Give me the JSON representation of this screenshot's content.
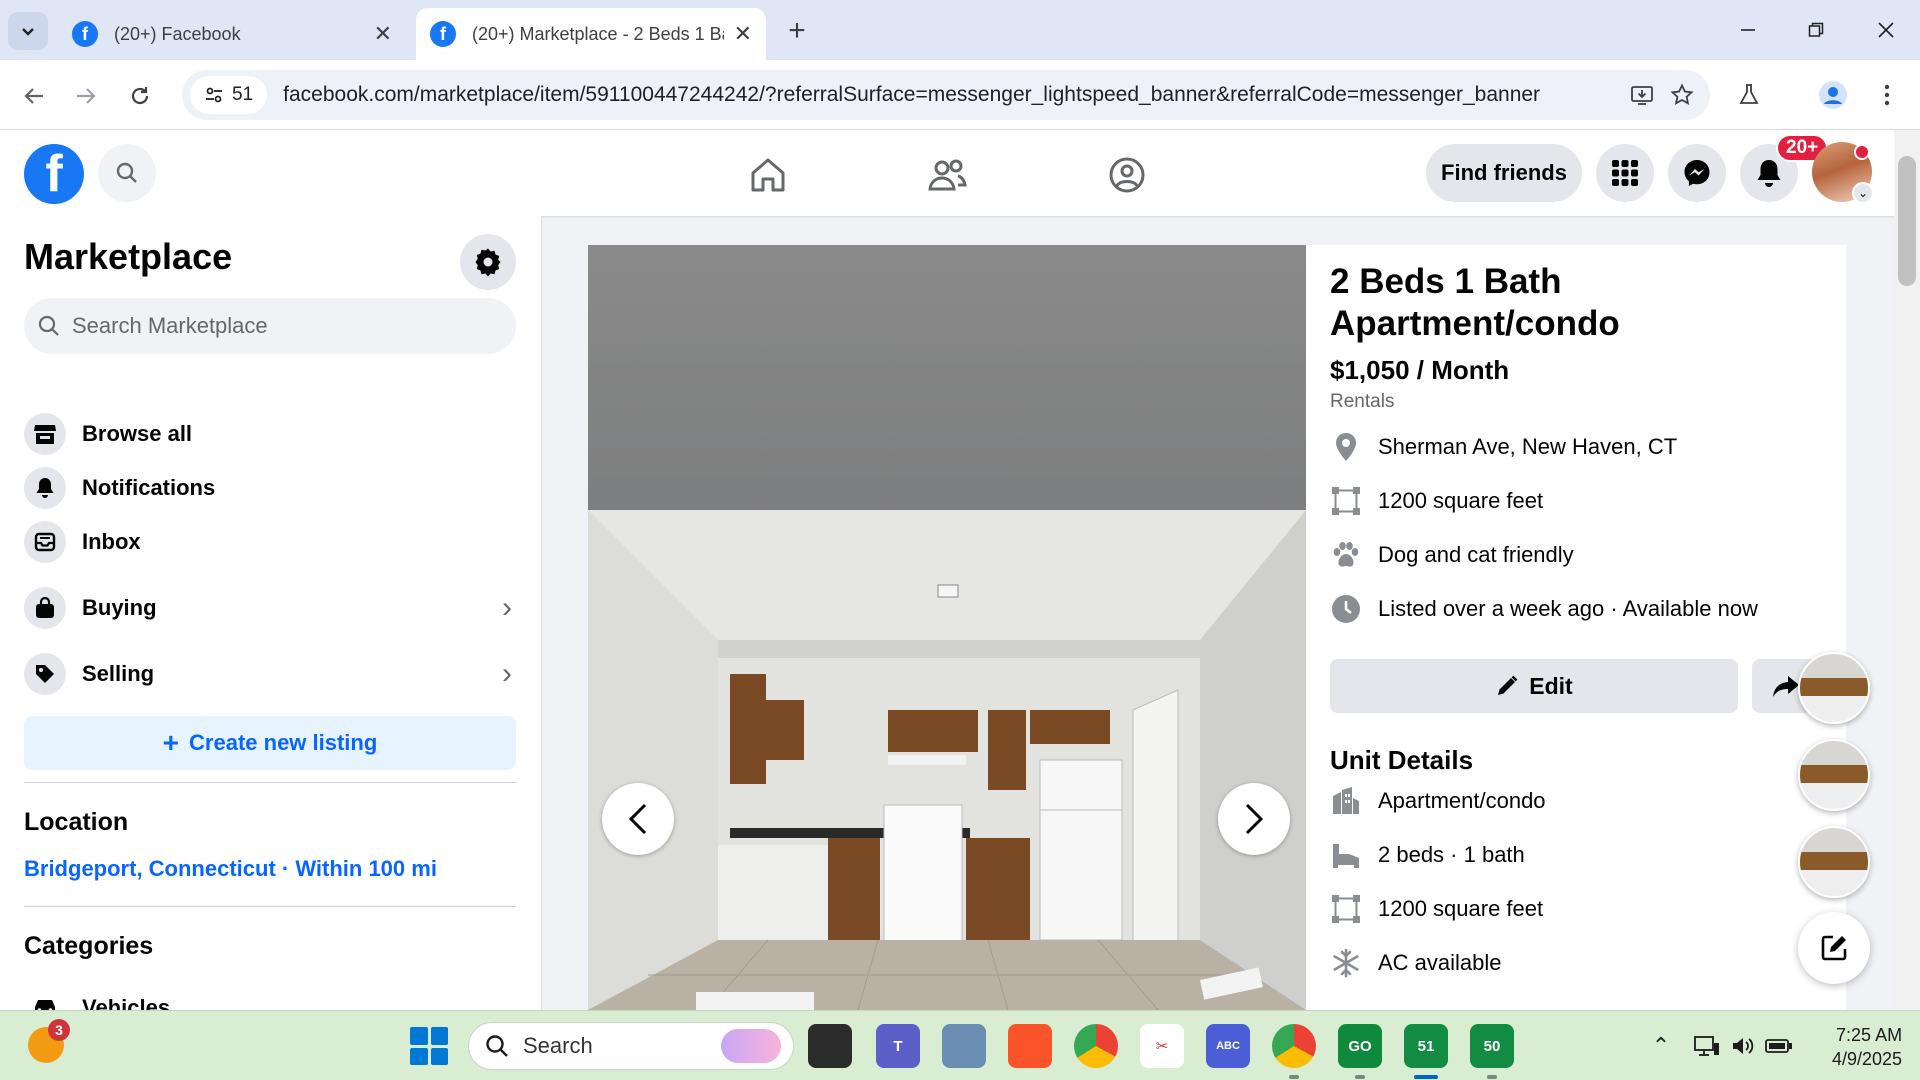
{
  "browser": {
    "tabs": [
      {
        "title": "(20+) Facebook",
        "active": false
      },
      {
        "title": "(20+) Marketplace - 2 Beds 1 Ba",
        "active": true
      }
    ],
    "site_chip_count": "51",
    "url": "facebook.com/marketplace/item/591100447244242/?referralSurface=messenger_lightspeed_banner&referralCode=messenger_banner"
  },
  "fb_header": {
    "logo": "f",
    "find_friends_label": "Find friends",
    "notifications_badge": "20+"
  },
  "sidebar": {
    "title": "Marketplace",
    "search_placeholder": "Search Marketplace",
    "items": [
      {
        "label": "Browse all",
        "icon": "storefront-icon"
      },
      {
        "label": "Notifications",
        "icon": "bell-icon"
      },
      {
        "label": "Inbox",
        "icon": "inbox-icon"
      },
      {
        "label": "Buying",
        "icon": "shopping-bag-icon"
      },
      {
        "label": "Selling",
        "icon": "price-tag-icon"
      }
    ],
    "create_listing_label": "Create new listing",
    "location_heading": "Location",
    "location_value": "Bridgeport, Connecticut · Within 100 mi",
    "categories_heading": "Categories",
    "first_category": "Vehicles"
  },
  "listing": {
    "title": "2 Beds 1 Bath Apartment/condo",
    "price": "$1,050 / Month",
    "category": "Rentals",
    "facts": [
      {
        "text": "Sherman Ave, New Haven, CT",
        "icon": "location-pin-icon"
      },
      {
        "text": "1200 square feet",
        "icon": "area-icon"
      },
      {
        "text": "Dog and cat friendly",
        "icon": "paw-icon"
      },
      {
        "text": "Listed over a week ago · Available now",
        "icon": "clock-icon"
      }
    ],
    "edit_label": "Edit",
    "unit_details_heading": "Unit Details",
    "unit_details": [
      {
        "text": "Apartment/condo",
        "icon": "building-icon"
      },
      {
        "text": "2 beds · 1 bath",
        "icon": "bed-icon"
      },
      {
        "text": "1200 square feet",
        "icon": "area-icon"
      },
      {
        "text": "AC available",
        "icon": "snowflake-icon"
      }
    ]
  },
  "taskbar": {
    "weather_badge": "3",
    "search_placeholder": "Search",
    "app_51": "51",
    "app_50": "50",
    "time": "7:25 AM",
    "date": "4/9/2025"
  },
  "colors": {
    "facebook_blue": "#1877f2",
    "link_blue": "#0866ff",
    "badge_red": "#e41e3f"
  }
}
